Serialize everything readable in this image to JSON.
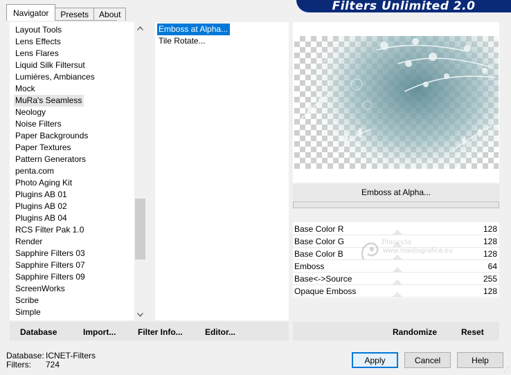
{
  "tabs": [
    {
      "label": "Navigator",
      "active": true
    },
    {
      "label": "Presets",
      "active": false
    },
    {
      "label": "About",
      "active": false
    }
  ],
  "banner": {
    "title": "Filters Unlimited 2.0"
  },
  "filter_list": {
    "items": [
      "Layout Tools",
      "Lens Effects",
      "Lens Flares",
      "Liquid Silk Filtersut",
      "Lumières, Ambiances",
      "Mock",
      "MuRa's Seamless",
      "Neology",
      "Noise Filters",
      "Paper Backgrounds",
      "Paper Textures",
      "Pattern Generators",
      "penta.com",
      "Photo Aging Kit",
      "Plugins AB 01",
      "Plugins AB 02",
      "Plugins AB 04",
      "RCS Filter Pak 1.0",
      "Render",
      "Sapphire Filters 03",
      "Sapphire Filters 07",
      "Sapphire Filters 09",
      "ScreenWorks",
      "Scribe",
      "Simple"
    ],
    "highlighted": "MuRa's Seamless"
  },
  "sub_filters": {
    "items": [
      "Emboss at Alpha...",
      "Tile Rotate..."
    ],
    "selected": "Emboss at Alpha..."
  },
  "current_filter": "Emboss at Alpha...",
  "params": [
    {
      "name": "Base Color R",
      "value": "128"
    },
    {
      "name": "Base Color G",
      "value": "128"
    },
    {
      "name": "Base Color B",
      "value": "128"
    },
    {
      "name": "Emboss",
      "value": "64"
    },
    {
      "name": "Base<->Source",
      "value": "255"
    },
    {
      "name": "Opaque Emboss",
      "value": "128"
    }
  ],
  "watermark": {
    "script": "Pinuccia",
    "url": "www.maidisgrafica.eu"
  },
  "commands_left": [
    "Database",
    "Import...",
    "Filter Info...",
    "Editor..."
  ],
  "commands_right": [
    "Randomize",
    "Reset"
  ],
  "footer": {
    "database_label": "Database:",
    "database_value": "ICNET-Filters",
    "filters_label": "Filters:",
    "filters_value": "724"
  },
  "buttons": {
    "apply": "Apply",
    "cancel": "Cancel",
    "help": "Help"
  },
  "icons": {
    "scroll_up": "chevron-up-icon",
    "scroll_down": "chevron-down-icon"
  }
}
